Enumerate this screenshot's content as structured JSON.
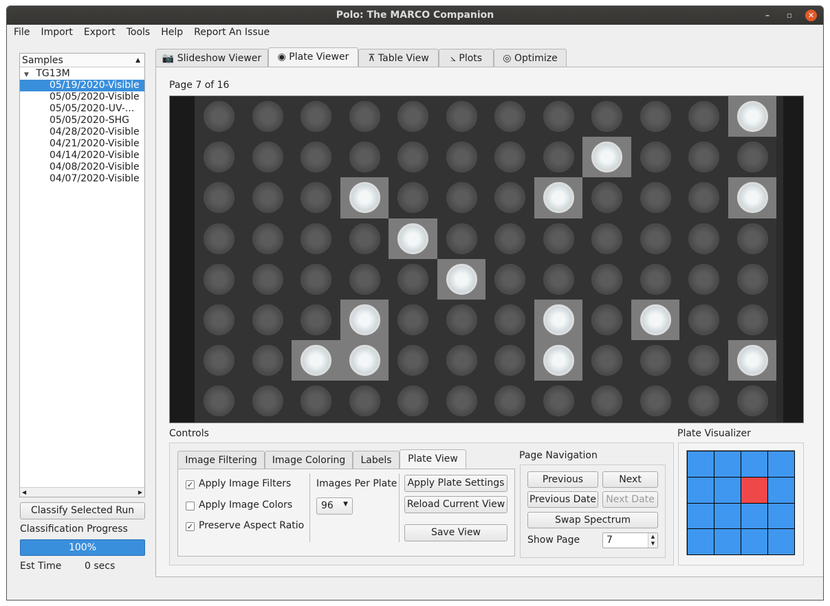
{
  "window": {
    "title": "Polo: The MARCO Companion",
    "minimize_glyph": "–",
    "restore_glyph": "▫",
    "close_glyph": "✕"
  },
  "menu": [
    "File",
    "Import",
    "Export",
    "Tools",
    "Help",
    "Report An Issue"
  ],
  "samples": {
    "header": "Samples",
    "root": "TG13M",
    "runs": [
      "05/19/2020-Visible",
      "05/05/2020-Visible",
      "05/05/2020-UV-...",
      "05/05/2020-SHG",
      "04/28/2020-Visible",
      "04/21/2020-Visible",
      "04/14/2020-Visible",
      "04/08/2020-Visible",
      "04/07/2020-Visible"
    ],
    "selected_index": 0
  },
  "classify": {
    "button": "Classify Selected Run",
    "progress_label": "Classification Progress",
    "progress_text": "100%",
    "progress_value": 1.0,
    "est_label": "Est Time",
    "est_value": "0 secs"
  },
  "tabs": [
    {
      "label": "Slideshow Viewer",
      "icon": "camera-icon"
    },
    {
      "label": "Plate Viewer",
      "icon": "eye-icon"
    },
    {
      "label": "Table View",
      "icon": "table-icon"
    },
    {
      "label": "Plots",
      "icon": "chart-icon"
    },
    {
      "label": "Optimize",
      "icon": "target-icon"
    }
  ],
  "active_tab": "Plate Viewer",
  "page_label": "Page 7 of 16",
  "plate": {
    "rows": 8,
    "cols": 12,
    "bright_wells": [
      [
        0,
        11
      ],
      [
        1,
        8
      ],
      [
        2,
        3
      ],
      [
        2,
        7
      ],
      [
        2,
        11
      ],
      [
        3,
        4
      ],
      [
        4,
        5
      ],
      [
        5,
        3
      ],
      [
        5,
        7
      ],
      [
        5,
        9
      ],
      [
        6,
        2
      ],
      [
        6,
        3
      ],
      [
        6,
        7
      ],
      [
        6,
        11
      ]
    ]
  },
  "controls": {
    "title": "Controls",
    "tabs": [
      "Image Filtering",
      "Image Coloring",
      "Labels",
      "Plate View"
    ],
    "active_tab": "Plate View",
    "checkboxes": [
      {
        "label": "Apply Image Filters",
        "checked": true
      },
      {
        "label": "Apply Image Colors",
        "checked": false
      },
      {
        "label": "Preserve Aspect Ratio",
        "checked": true
      }
    ],
    "images_per_plate_label": "Images Per Plate",
    "images_per_plate_value": "96",
    "apply_plate_settings": "Apply Plate Settings",
    "reload_current_view": "Reload Current View",
    "save_view": "Save View"
  },
  "page_nav": {
    "title": "Page Navigation",
    "previous": "Previous",
    "next": "Next",
    "previous_date": "Previous Date",
    "next_date": "Next Date",
    "swap_spectrum": "Swap Spectrum",
    "show_page_label": "Show Page",
    "show_page_value": "7"
  },
  "visualizer": {
    "title": "Plate Visualizer",
    "rows": 4,
    "cols": 4,
    "active_cell": [
      1,
      2
    ],
    "color_default": "#3f97f0",
    "color_active": "#f04848"
  }
}
